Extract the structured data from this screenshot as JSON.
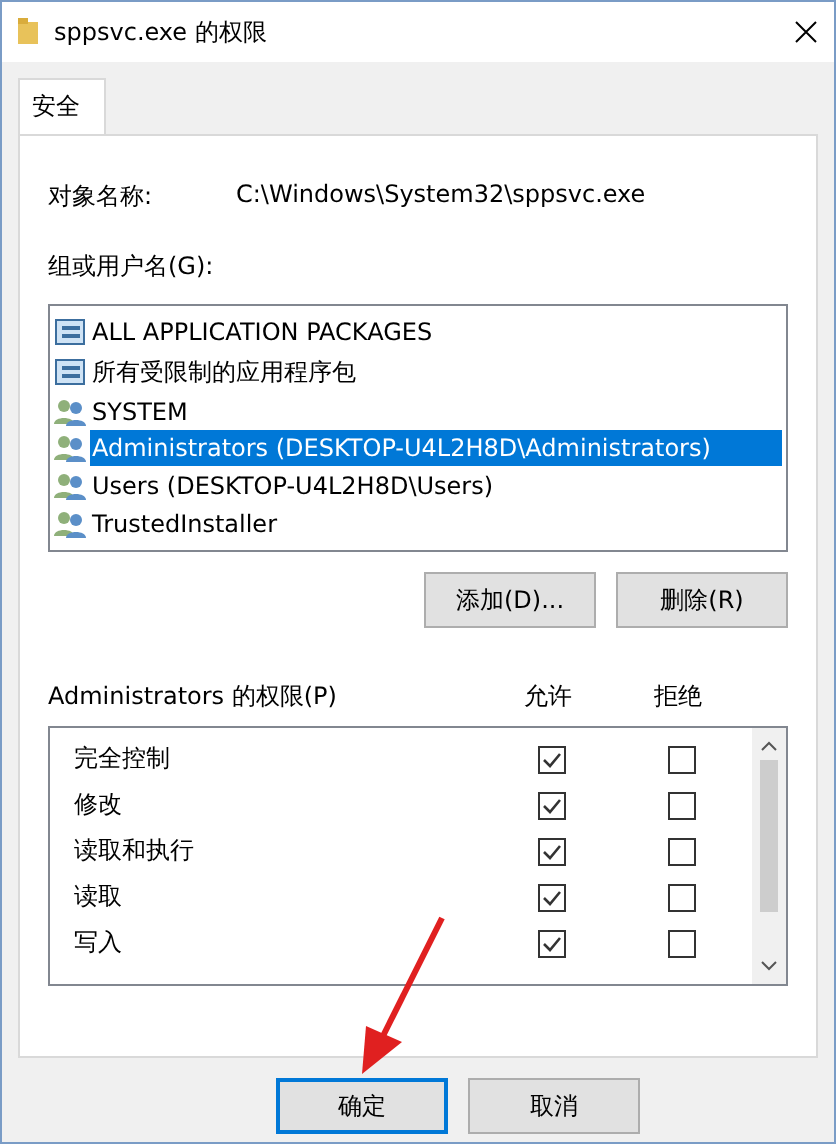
{
  "window": {
    "title": "sppsvc.exe 的权限"
  },
  "tabs": [
    {
      "label": "安全",
      "selected": true
    }
  ],
  "object_name": {
    "label": "对象名称:",
    "value": "C:\\Windows\\System32\\sppsvc.exe"
  },
  "groups": {
    "label": "组或用户名(G):",
    "items": [
      {
        "name": "ALL APPLICATION PACKAGES",
        "kind": "package",
        "selected": false
      },
      {
        "name": "所有受限制的应用程序包",
        "kind": "package",
        "selected": false
      },
      {
        "name": "SYSTEM",
        "kind": "user",
        "selected": false
      },
      {
        "name": "Administrators (DESKTOP-U4L2H8D\\Administrators)",
        "kind": "user",
        "selected": true
      },
      {
        "name": "Users (DESKTOP-U4L2H8D\\Users)",
        "kind": "user",
        "selected": false
      },
      {
        "name": "TrustedInstaller",
        "kind": "user",
        "selected": false
      }
    ],
    "buttons": [
      "添加(D)...",
      "删除(R)"
    ]
  },
  "permissions": {
    "label": "Administrators 的权限(P)",
    "allow_header": "允许",
    "deny_header": "拒绝",
    "rows": [
      {
        "name": "完全控制",
        "allow": true,
        "deny": false
      },
      {
        "name": "修改",
        "allow": true,
        "deny": false
      },
      {
        "name": "读取和执行",
        "allow": true,
        "deny": false
      },
      {
        "name": "读取",
        "allow": true,
        "deny": false
      },
      {
        "name": "写入",
        "allow": true,
        "deny": false
      }
    ]
  },
  "footer_buttons": [
    {
      "label": "确定",
      "focused": true
    },
    {
      "label": "取消",
      "focused": false
    }
  ]
}
